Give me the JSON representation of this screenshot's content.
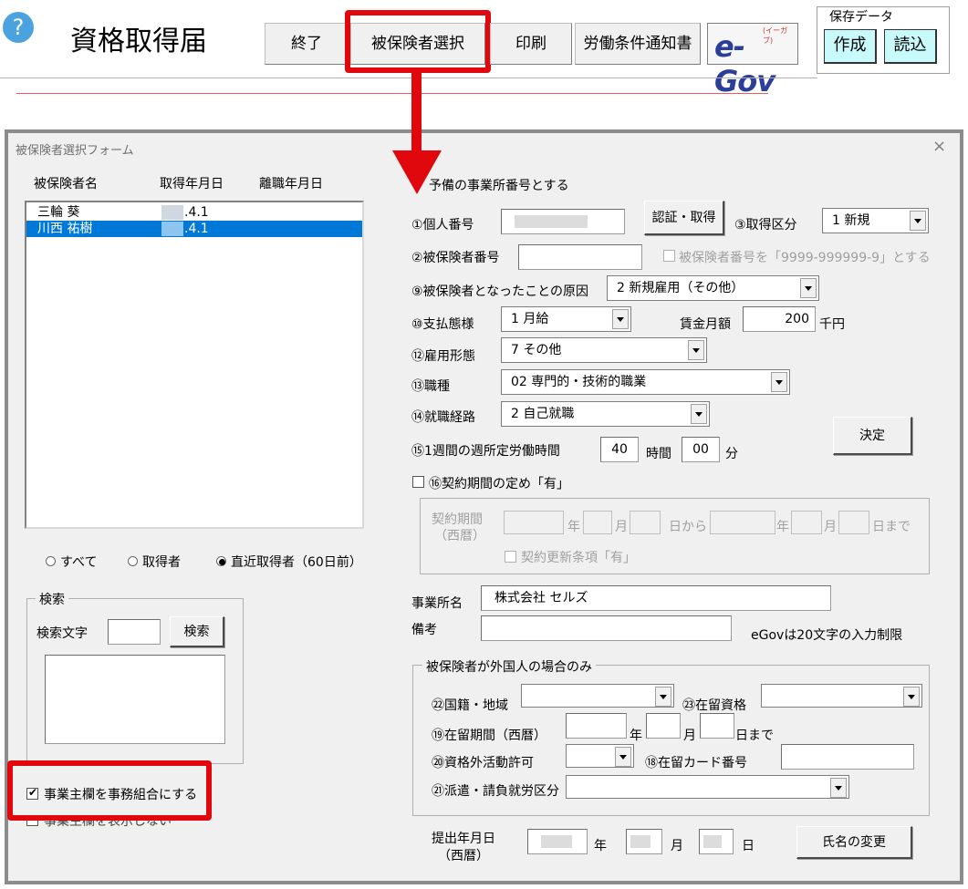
{
  "toolbar": {
    "help_glyph": "?",
    "title": "資格取得届",
    "buttons": [
      "終了",
      "被保険者選択",
      "印刷",
      "労働条件通知書"
    ],
    "egov_logo": "e-Gov",
    "egov_ruby": "(イーガブ)",
    "save_group_label": "保存データ",
    "save_create": "作成",
    "save_load": "読込"
  },
  "form": {
    "title": "被保険者選択フォーム",
    "close_glyph": "×",
    "list_headers": [
      "被保険者名",
      "取得年月日",
      "離職年月日"
    ],
    "list_rows": [
      {
        "name": "三輪 葵",
        "date": ".4.1",
        "selected": false
      },
      {
        "name": "川西 祐樹",
        "date": ".4.1",
        "selected": true
      }
    ],
    "filters": {
      "all": "すべて",
      "acquired": "取得者",
      "recent": "直近取得者（60日前）",
      "selected": "recent"
    },
    "search": {
      "legend": "検索",
      "label": "検索文字",
      "value": "",
      "button": "検索"
    },
    "office_union_checkbox": "事業主欄を事務組合にする",
    "hidden_checkbox": "事業主欄を表示しない",
    "spare_office": "予備の事業所番号とする",
    "individual_number": {
      "label": "①個人番号",
      "button": "認証・取得"
    },
    "acquisition_type": {
      "label": "③取得区分",
      "value": "1 新規"
    },
    "insured_number": {
      "label": "②被保険者番号",
      "value": "",
      "checkbox": "被保険者番号を「9999-999999-9」とする"
    },
    "cause": {
      "label": "⑨被保険者となったことの原因",
      "value": "2  新規雇用（その他）"
    },
    "payment": {
      "label": "⑩支払態様",
      "value": "1  月給"
    },
    "wage": {
      "label": "賃金月額",
      "value": "200",
      "unit": "千円"
    },
    "employment_type": {
      "label": "⑫雇用形態",
      "value": "7  その他"
    },
    "occupation": {
      "label": "⑬職種",
      "value": "02  専門的・技術的職業"
    },
    "route": {
      "label": "⑭就職経路",
      "value": "2  自己就職"
    },
    "confirm_button": "決定",
    "weekly_hours": {
      "label": "⑮1週間の週所定労働時間",
      "hours": "40",
      "hours_unit": "時間",
      "minutes": "00",
      "minutes_unit": "分"
    },
    "contract": {
      "checkbox": "⑯契約期間の定め「有」",
      "period_label_1": "契約期間",
      "period_label_2": "（西暦）",
      "year": "年",
      "month": "月",
      "from": "日から",
      "until": "日まで",
      "renewal": "契約更新条項「有」"
    },
    "office_name": {
      "label": "事業所名",
      "value": "株式会社  セルズ"
    },
    "remarks": {
      "label": "備考",
      "value": "",
      "note": "eGovは20文字の入力制限"
    },
    "foreign": {
      "legend": "被保険者が外国人の場合のみ",
      "nationality": "㉒国籍・地域",
      "status": "㉓在留資格",
      "period": "⑲在留期間（西暦）",
      "year": "年",
      "month": "月",
      "until": "日まで",
      "permission": "⑳資格外活動許可",
      "card": "⑱在留カード番号",
      "dispatch": "㉑派遣・請負就労区分"
    },
    "submit_date": {
      "label_1": "提出年月日",
      "label_2": "（西暦）",
      "year": "年",
      "month": "月",
      "day": "日"
    },
    "rename_button": "氏名の変更"
  },
  "colors": {
    "highlight": "#e0080c",
    "selection": "#0078d7",
    "cyan": "#c8fafc"
  }
}
